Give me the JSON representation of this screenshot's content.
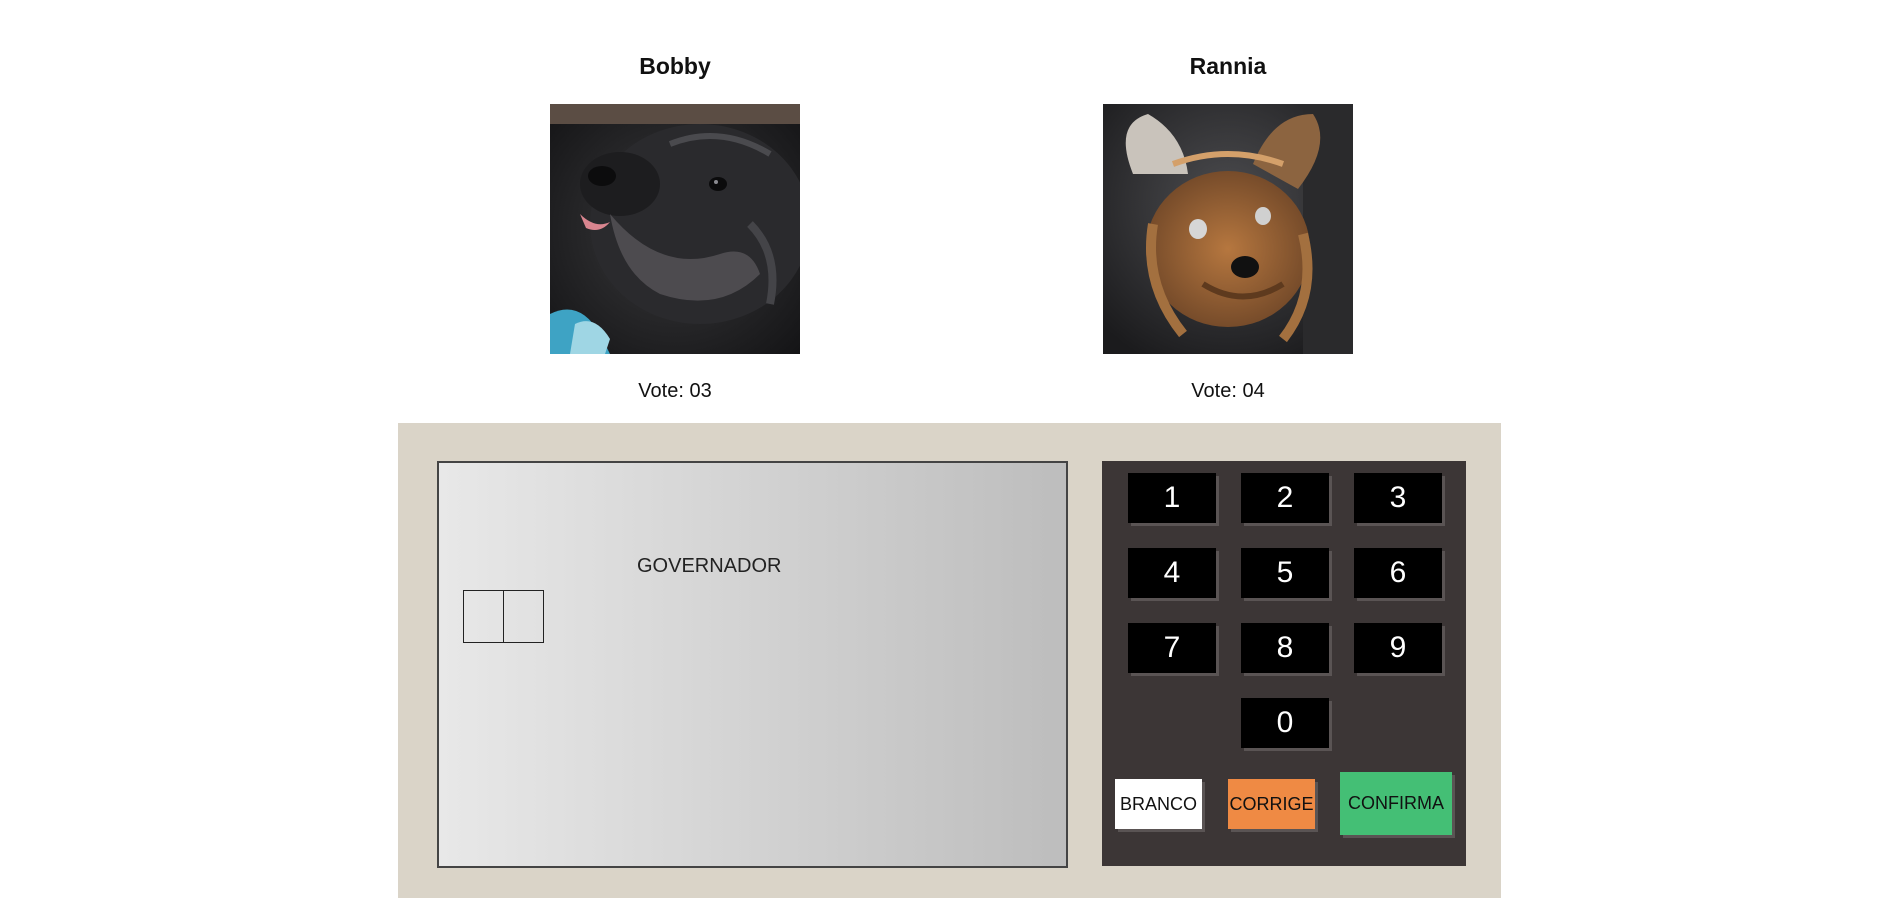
{
  "candidates": [
    {
      "name": "Bobby",
      "vote_label": "Vote: 03",
      "photo_icon": "black-dog-photo"
    },
    {
      "name": "Rannia",
      "vote_label": "Vote: 04",
      "photo_icon": "yorkshire-dog-photo"
    }
  ],
  "screen": {
    "title": "GOVERNADOR",
    "digits": [
      "",
      ""
    ]
  },
  "keypad": {
    "keys": [
      "1",
      "2",
      "3",
      "4",
      "5",
      "6",
      "7",
      "8",
      "9",
      "0"
    ],
    "branco": "BRANCO",
    "corrige": "CORRIGE",
    "confirma": "CONFIRMA"
  },
  "colors": {
    "urna_body": "#dad4c8",
    "keypad_bg": "#3c3636",
    "key_bg": "#000000",
    "branco": "#ffffff",
    "corrige": "#ef8a44",
    "confirma": "#44bf75"
  }
}
